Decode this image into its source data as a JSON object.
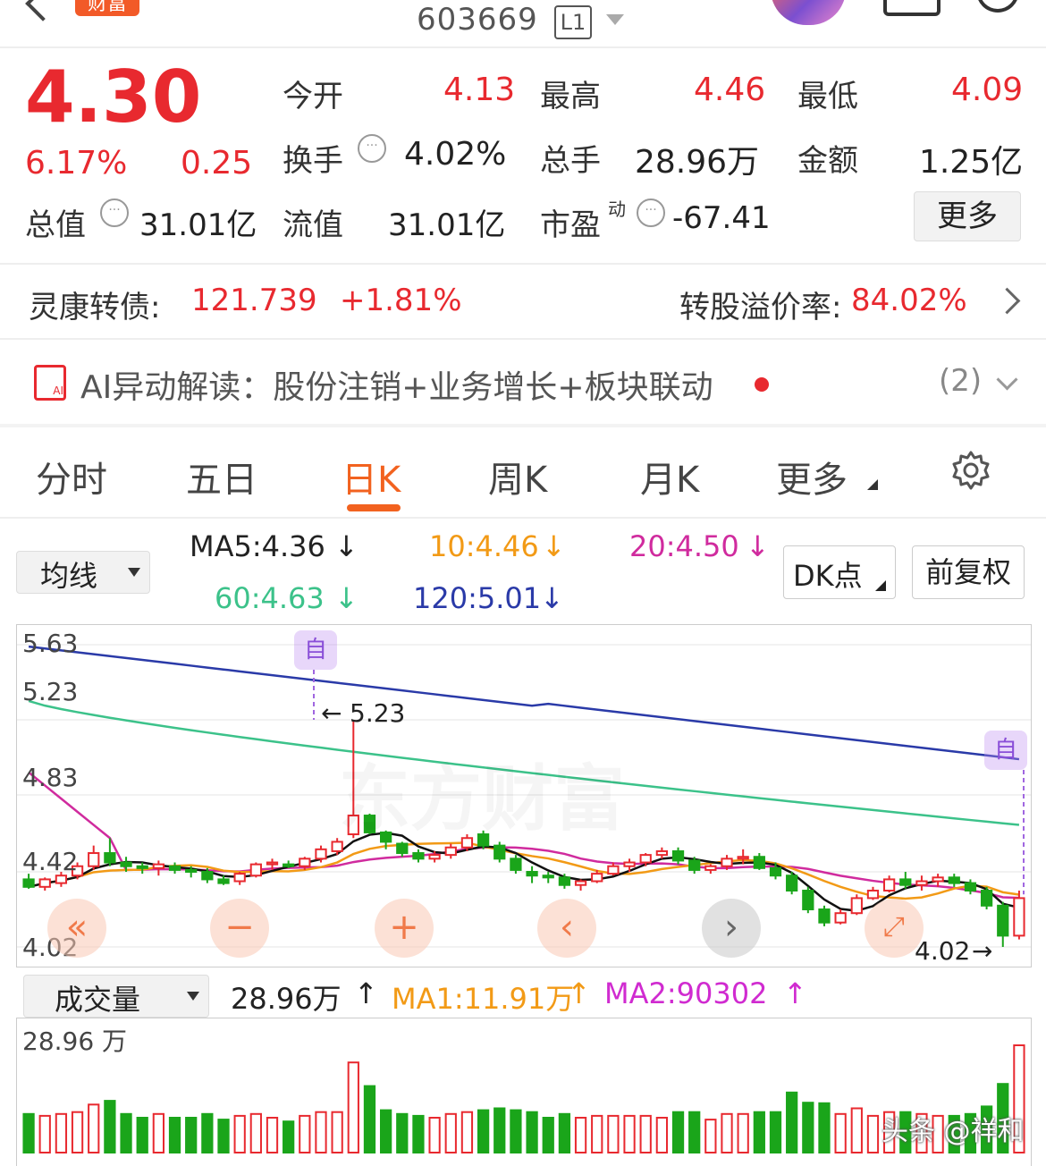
{
  "header": {
    "badge": "财富",
    "code": "603669",
    "level": "L1"
  },
  "quote": {
    "price": "4.30",
    "change_pct": "6.17%",
    "change": "0.25",
    "rows": [
      [
        {
          "label": "今开",
          "value": "4.13",
          "color": "#e8292f"
        },
        {
          "label": "最高",
          "value": "4.46",
          "color": "#e8292f"
        },
        {
          "label": "最低",
          "value": "4.09",
          "color": "#e8292f"
        }
      ],
      [
        {
          "label": "换手",
          "value": "4.02%",
          "color": "#222"
        },
        {
          "label": "总手",
          "value": "28.96万",
          "color": "#222"
        },
        {
          "label": "金额",
          "value": "1.25亿",
          "color": "#222"
        }
      ],
      [
        {
          "label": "总值",
          "value": "31.01亿",
          "color": "#222"
        },
        {
          "label": "流值",
          "value": "31.01亿",
          "color": "#222"
        },
        {
          "label": "市盈",
          "value": "-67.41",
          "color": "#222"
        }
      ]
    ],
    "pe_sup": "动",
    "more_label": "更多"
  },
  "bond": {
    "name": "灵康转债:",
    "price": "121.739",
    "pct": "+1.81%",
    "premium_label": "转股溢价率:",
    "premium_value": "84.02%"
  },
  "ai": {
    "text": "AI异动解读：股份注销+业务增长+板块联动",
    "count": "(2)"
  },
  "tabs": [
    "分时",
    "五日",
    "日K",
    "周K",
    "月K",
    "更多"
  ],
  "active_tab": "日K",
  "ma": {
    "selector": "均线",
    "items": [
      {
        "label": "MA5:4.36",
        "color": "#222"
      },
      {
        "label": "10:4.46",
        "color": "#f29a16"
      },
      {
        "label": "20:4.50",
        "color": "#d02b9e"
      },
      {
        "label": "60:4.63",
        "color": "#3cc28a"
      },
      {
        "label": "120:5.01",
        "color": "#2a3aa8"
      }
    ],
    "dk_label": "DK点",
    "adjust_label": "前复权"
  },
  "chart_labels": {
    "high_marker": "5.23",
    "low_marker": "4.02",
    "flag": "自",
    "watermark": "东方财富"
  },
  "volume": {
    "selector": "成交量",
    "value": "28.96万",
    "ma1": "MA1:11.91万",
    "ma2": "MA2:90302",
    "ylabel": "28.96 万"
  },
  "watermark_footer": "头条 @祥和",
  "chart_data": {
    "type": "candlestick",
    "y_ticks": [
      5.63,
      5.23,
      4.83,
      4.42,
      4.02
    ],
    "ylim": [
      4.02,
      5.63
    ],
    "ohlc": [
      [
        4.38,
        4.41,
        4.33,
        4.34
      ],
      [
        4.34,
        4.39,
        4.32,
        4.38
      ],
      [
        4.36,
        4.42,
        4.34,
        4.4
      ],
      [
        4.4,
        4.47,
        4.38,
        4.45
      ],
      [
        4.45,
        4.56,
        4.43,
        4.52
      ],
      [
        4.52,
        4.6,
        4.45,
        4.47
      ],
      [
        4.47,
        4.5,
        4.42,
        4.45
      ],
      [
        4.45,
        4.47,
        4.41,
        4.44
      ],
      [
        4.44,
        4.48,
        4.4,
        4.46
      ],
      [
        4.45,
        4.47,
        4.41,
        4.43
      ],
      [
        4.43,
        4.45,
        4.39,
        4.42
      ],
      [
        4.42,
        4.44,
        4.36,
        4.38
      ],
      [
        4.38,
        4.4,
        4.35,
        4.36
      ],
      [
        4.37,
        4.42,
        4.35,
        4.41
      ],
      [
        4.4,
        4.47,
        4.39,
        4.46
      ],
      [
        4.46,
        4.49,
        4.43,
        4.47
      ],
      [
        4.46,
        4.48,
        4.44,
        4.45
      ],
      [
        4.45,
        4.5,
        4.43,
        4.49
      ],
      [
        4.49,
        4.56,
        4.47,
        4.54
      ],
      [
        4.53,
        4.6,
        4.51,
        4.58
      ],
      [
        4.62,
        5.23,
        4.6,
        4.72
      ],
      [
        4.72,
        4.73,
        4.62,
        4.63
      ],
      [
        4.63,
        4.64,
        4.54,
        4.58
      ],
      [
        4.57,
        4.58,
        4.5,
        4.52
      ],
      [
        4.52,
        4.54,
        4.47,
        4.49
      ],
      [
        4.49,
        4.53,
        4.47,
        4.51
      ],
      [
        4.51,
        4.57,
        4.49,
        4.55
      ],
      [
        4.55,
        4.62,
        4.53,
        4.6
      ],
      [
        4.62,
        4.64,
        4.54,
        4.56
      ],
      [
        4.56,
        4.58,
        4.47,
        4.49
      ],
      [
        4.49,
        4.51,
        4.41,
        4.43
      ],
      [
        4.42,
        4.45,
        4.36,
        4.4
      ],
      [
        4.4,
        4.42,
        4.36,
        4.39
      ],
      [
        4.39,
        4.41,
        4.33,
        4.35
      ],
      [
        4.35,
        4.38,
        4.32,
        4.37
      ],
      [
        4.37,
        4.43,
        4.36,
        4.41
      ],
      [
        4.41,
        4.47,
        4.4,
        4.45
      ],
      [
        4.45,
        4.49,
        4.42,
        4.47
      ],
      [
        4.47,
        4.52,
        4.45,
        4.51
      ],
      [
        4.51,
        4.55,
        4.49,
        4.53
      ],
      [
        4.53,
        4.55,
        4.46,
        4.48
      ],
      [
        4.48,
        4.5,
        4.41,
        4.43
      ],
      [
        4.43,
        4.46,
        4.41,
        4.45
      ],
      [
        4.45,
        4.51,
        4.43,
        4.49
      ],
      [
        4.49,
        4.54,
        4.46,
        4.5
      ],
      [
        4.5,
        4.52,
        4.43,
        4.44
      ],
      [
        4.44,
        4.47,
        4.38,
        4.4
      ],
      [
        4.4,
        4.42,
        4.3,
        4.32
      ],
      [
        4.32,
        4.34,
        4.2,
        4.22
      ],
      [
        4.22,
        4.24,
        4.13,
        4.15
      ],
      [
        4.15,
        4.22,
        4.14,
        4.2
      ],
      [
        4.2,
        4.3,
        4.19,
        4.28
      ],
      [
        4.28,
        4.34,
        4.27,
        4.32
      ],
      [
        4.32,
        4.4,
        4.31,
        4.38
      ],
      [
        4.38,
        4.42,
        4.33,
        4.35
      ],
      [
        4.35,
        4.4,
        4.32,
        4.37
      ],
      [
        4.37,
        4.41,
        4.34,
        4.39
      ],
      [
        4.39,
        4.41,
        4.34,
        4.36
      ],
      [
        4.36,
        4.38,
        4.3,
        4.32
      ],
      [
        4.32,
        4.34,
        4.22,
        4.24
      ],
      [
        4.24,
        4.26,
        4.02,
        4.08
      ],
      [
        4.08,
        4.32,
        4.06,
        4.28
      ]
    ],
    "volume_max": "28.96万"
  }
}
